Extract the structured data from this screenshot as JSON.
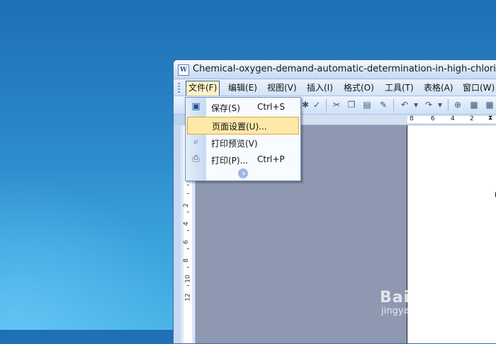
{
  "window": {
    "title": "Chemical-oxygen-demand-automatic-determination-in-high-chlorine-wat",
    "icon": "word-document-icon"
  },
  "menubar": {
    "items": [
      {
        "label": "文件(F)",
        "active": true
      },
      {
        "label": "编辑(E)"
      },
      {
        "label": "视图(V)"
      },
      {
        "label": "插入(I)"
      },
      {
        "label": "格式(O)"
      },
      {
        "label": "工具(T)"
      },
      {
        "label": "表格(A)"
      },
      {
        "label": "窗口(W)"
      }
    ]
  },
  "file_menu": {
    "items": [
      {
        "label": "保存(S)",
        "shortcut": "Ctrl+S",
        "icon": "save-icon"
      },
      {
        "label": "页面设置(U)...",
        "shortcut": "",
        "icon": "",
        "highlighted": true
      },
      {
        "label": "打印预览(V)",
        "shortcut": "",
        "icon": "print-preview-icon"
      },
      {
        "label": "打印(P)...",
        "shortcut": "Ctrl+P",
        "icon": "print-icon"
      }
    ],
    "expand_icon": "chevron-double-down-icon"
  },
  "ruler": {
    "horizontal_numbers": [
      "8",
      "6",
      "4",
      "2"
    ],
    "vertical_numbers": [
      "2",
      "4",
      "6",
      "8",
      "10",
      "12"
    ]
  },
  "watermark": {
    "logo": "Bai经验",
    "site": "jingyan.baidu.com"
  }
}
